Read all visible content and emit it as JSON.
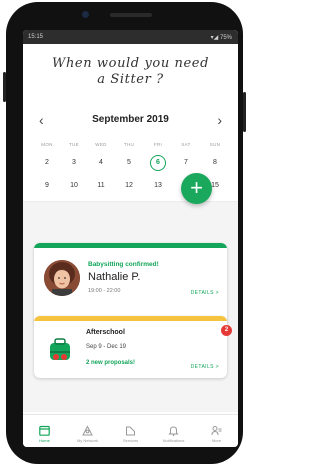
{
  "status_bar": {
    "time": "15:15",
    "signal": "▾◢",
    "battery": "75%"
  },
  "question": {
    "line1": "When would you need",
    "line2": "a Sitter ?"
  },
  "calendar": {
    "month_label": "September 2019",
    "weekdays": [
      "MON",
      "TUE",
      "WED",
      "THU",
      "FRI",
      "SAT",
      "SUN"
    ],
    "week1": [
      "2",
      "3",
      "4",
      "5",
      "6",
      "7",
      "8"
    ],
    "week2": [
      "9",
      "10",
      "11",
      "12",
      "13",
      "14",
      "15"
    ],
    "selected_day": "6"
  },
  "fab": {
    "label": "+"
  },
  "cards": [
    {
      "status": "Babysitting confirmed!",
      "name": "Nathalie P.",
      "hours": "19:00 - 22:00",
      "details_label": "DETAILS >"
    },
    {
      "title": "Afterschool",
      "dates": "Sep 9 - Dec 19",
      "proposals": "2 new proposals!",
      "details_label": "DETAILS >",
      "badge_count": "2"
    }
  ],
  "nav": [
    {
      "label": "Home",
      "icon": "calendar-icon"
    },
    {
      "label": "My Network",
      "icon": "network-icon"
    },
    {
      "label": "Services",
      "icon": "services-icon"
    },
    {
      "label": "Notifications",
      "icon": "bell-icon"
    },
    {
      "label": "More",
      "icon": "more-icon"
    }
  ],
  "colors": {
    "accent": "#13a55a",
    "warning": "#f6c33e",
    "badge": "#e53935"
  }
}
